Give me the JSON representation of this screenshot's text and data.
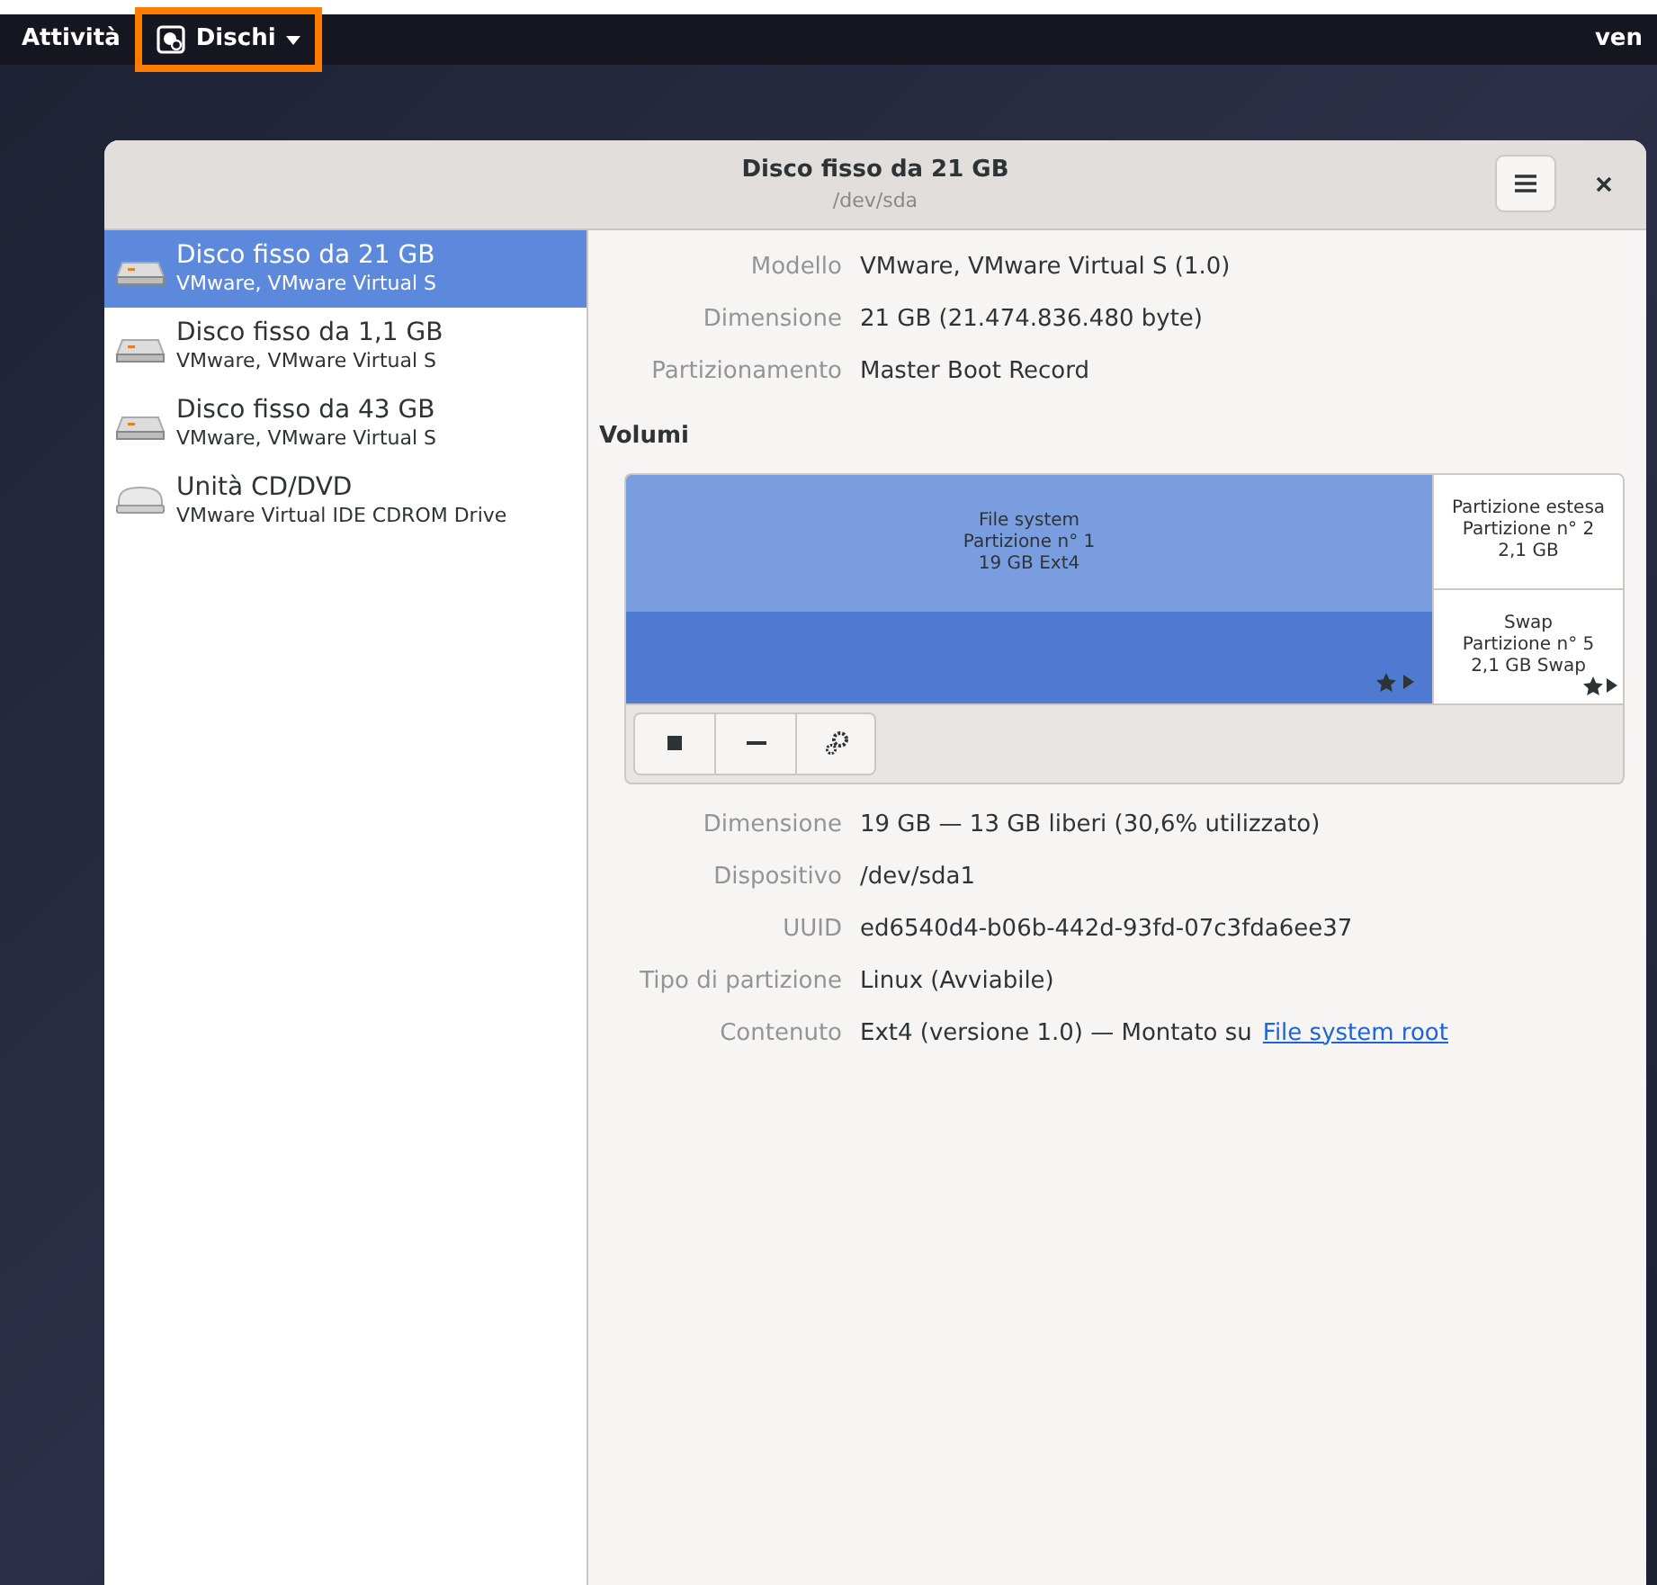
{
  "top_bar": {
    "activities": "Attività",
    "app_menu": {
      "label": "Dischi",
      "highlighted": true
    },
    "clock": "ven"
  },
  "window": {
    "title": "Disco fisso da 21 GB",
    "subtitle": "/dev/sda"
  },
  "drives": [
    {
      "name": "Disco fisso da 21 GB",
      "detail": "VMware, VMware Virtual S",
      "kind": "disk",
      "selected": true
    },
    {
      "name": "Disco fisso da 1,1 GB",
      "detail": "VMware, VMware Virtual S",
      "kind": "disk",
      "selected": false
    },
    {
      "name": "Disco fisso da 43 GB",
      "detail": "VMware, VMware Virtual S",
      "kind": "disk",
      "selected": false
    },
    {
      "name": "Unità CD/DVD",
      "detail": "VMware Virtual IDE CDROM Drive",
      "kind": "optical",
      "selected": false
    }
  ],
  "drive_info": [
    {
      "label": "Modello",
      "value": "VMware, VMware Virtual S (1.0)"
    },
    {
      "label": "Dimensione",
      "value": "21 GB (21.474.836.480 byte)"
    },
    {
      "label": "Partizionamento",
      "value": "Master Boot Record"
    }
  ],
  "volumes": {
    "heading": "Volumi",
    "partitions": [
      {
        "lines": [
          "File system",
          "Partizione n° 1",
          "19 GB Ext4"
        ],
        "selected": true
      }
    ],
    "extended": {
      "lines": [
        "Partizione estesa",
        "Partizione n° 2",
        "2,1 GB"
      ],
      "selected": false,
      "children": [
        {
          "lines": [
            "Swap",
            "Partizione n° 5",
            "2,1 GB Swap"
          ],
          "selected": false
        }
      ]
    }
  },
  "partition_info": [
    {
      "label": "Dimensione",
      "value": "19 GB — 13 GB liberi (30,6% utilizzato)"
    },
    {
      "label": "Dispositivo",
      "value": "/dev/sda1"
    },
    {
      "label": "UUID",
      "value": "ed6540d4-b06b-442d-93fd-07c3fda6ee37"
    },
    {
      "label": "Tipo di partizione",
      "value": "Linux (Avviabile)"
    },
    {
      "label": "Contenuto",
      "value": "Ext4 (versione 1.0) — Montato su",
      "link": "File system root"
    }
  ]
}
